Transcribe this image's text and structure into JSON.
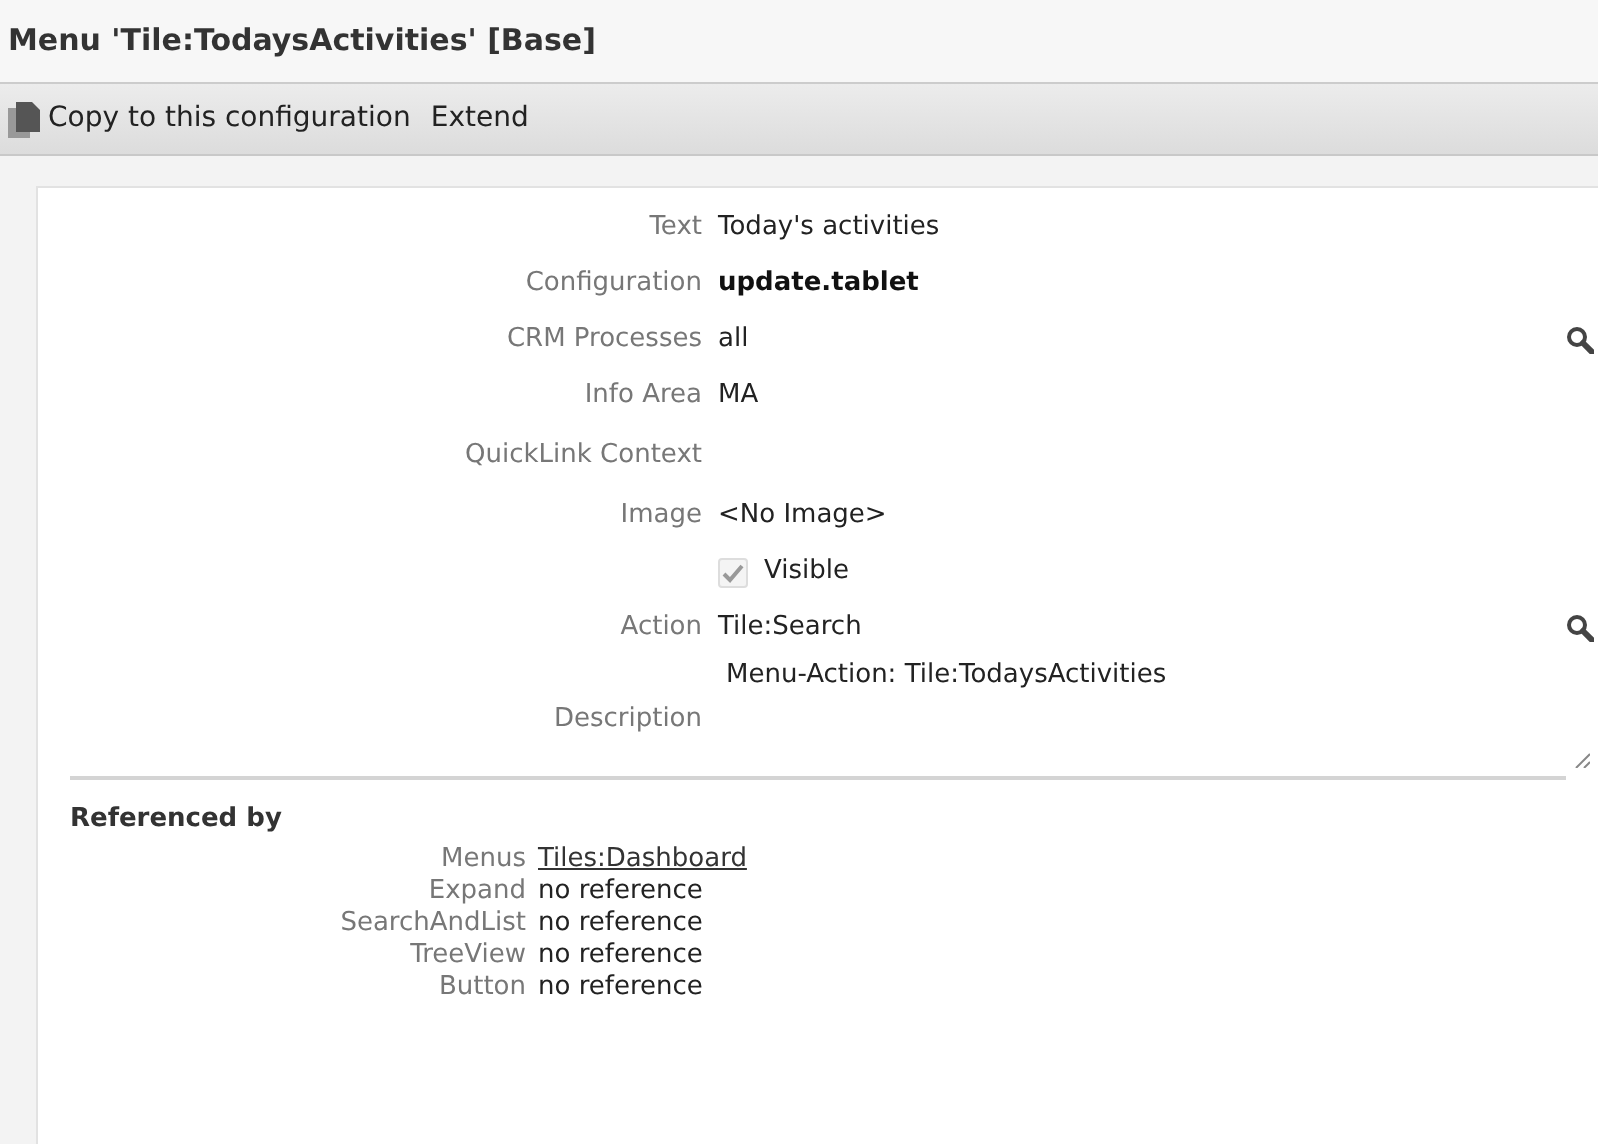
{
  "window": {
    "title": "Menu 'Tile:TodaysActivities' [Base]"
  },
  "toolbar": [
    {
      "label": "Copy to this configuration",
      "kind": "copy"
    },
    {
      "label": "Extend",
      "kind": "plain"
    }
  ],
  "fields": [
    {
      "label": "Text",
      "value": "Today's activities",
      "kind": "text"
    },
    {
      "label": "Configuration",
      "value": "update.tablet",
      "kind": "bold"
    },
    {
      "label": "CRM Processes",
      "value": "all",
      "kind": "lookup"
    },
    {
      "label": "Info Area",
      "value": "MA",
      "kind": "text"
    },
    {
      "label": "QuickLink Context",
      "kind": "empty"
    },
    {
      "label": "Image",
      "value": "<No Image>",
      "kind": "text"
    },
    {
      "value": "Visible",
      "kind": "checkbox",
      "checked": true,
      "disabled": true
    },
    {
      "label": "Action",
      "value": "Tile:Search",
      "kind": "lookup"
    },
    {
      "label": "Description",
      "value": "Menu-Action: Tile:TodaysActivities",
      "kind": "textarea"
    }
  ],
  "referenced_by": {
    "title": "Referenced by",
    "rows": [
      {
        "label": "Menus",
        "value": "Tiles:Dashboard",
        "kind": "link"
      },
      {
        "label": "Expand",
        "value": "no reference",
        "kind": "text"
      },
      {
        "label": "SearchAndList",
        "value": "no reference",
        "kind": "text"
      },
      {
        "label": "TreeView",
        "value": "no reference",
        "kind": "text"
      },
      {
        "label": "Button",
        "value": "no reference",
        "kind": "text"
      }
    ]
  }
}
